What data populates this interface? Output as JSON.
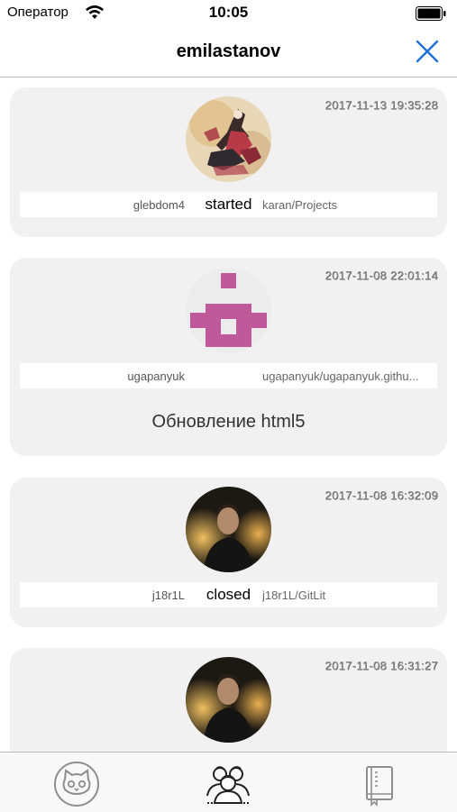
{
  "status": {
    "carrier": "Оператор",
    "time": "10:05"
  },
  "nav": {
    "title": "emilastanov",
    "close_icon": "close-icon"
  },
  "events": [
    {
      "date": "2017-11-13 19:35:28",
      "user": "glebdom4",
      "action": "started",
      "repo": "karan/Projects",
      "avatar": "artwork-avatar"
    },
    {
      "date": "2017-11-08 22:01:14",
      "user": "ugapanyuk",
      "action": "",
      "repo": "ugapanyuk/ugapanyuk.githu...",
      "message": "Обновление html5",
      "avatar": "identicon-avatar"
    },
    {
      "date": "2017-11-08 16:32:09",
      "user": "j18r1L",
      "action": "closed",
      "repo": "j18r1L/GitLit",
      "avatar": "photo-avatar"
    },
    {
      "date": "2017-11-08 16:31:27",
      "avatar": "photo-avatar"
    }
  ],
  "tabs": [
    {
      "icon": "github-cat-icon"
    },
    {
      "icon": "people-icon"
    },
    {
      "icon": "repository-book-icon"
    }
  ],
  "colors": {
    "accent": "#1e6fd9",
    "card_bg": "#f1f1f1",
    "identicon": "#c0599b"
  }
}
